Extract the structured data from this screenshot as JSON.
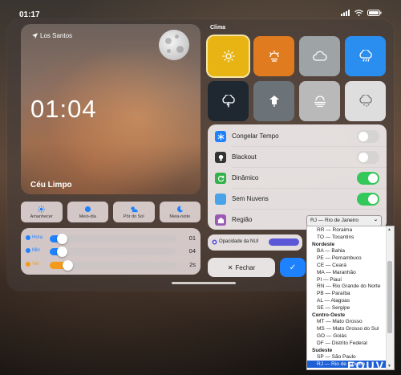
{
  "statusbar": {
    "time": "01:17"
  },
  "weather": {
    "location": "Los Santos",
    "clock": "01:04",
    "condition": "Céu Limpo"
  },
  "time_of_day": [
    {
      "label": "Amanhecer",
      "icon": "sun-icon"
    },
    {
      "label": "Meio-dia",
      "icon": "sun-full-icon"
    },
    {
      "label": "Pôr do Sol",
      "icon": "sunset-icon"
    },
    {
      "label": "Meia-noite",
      "icon": "moon-icon"
    }
  ],
  "sliders": [
    {
      "label": "Hora",
      "value": "01",
      "color": "#1e82ff",
      "fraction": 0.06
    },
    {
      "label": "Min",
      "value": "04",
      "color": "#1e82ff",
      "fraction": 0.06
    },
    {
      "label": "Vel",
      "value": "2s",
      "color": "#f39a1a",
      "fraction": 0.1
    }
  ],
  "clima": {
    "title": "Clima",
    "types": [
      {
        "name": "clear-sun-icon",
        "color": "#e8b414",
        "selected": true
      },
      {
        "name": "haze-sun-icon",
        "color": "#e07b1f",
        "selected": false
      },
      {
        "name": "cloud-icon",
        "color": "#9ea3a6",
        "selected": false
      },
      {
        "name": "rain-cloud-icon",
        "color": "#2a8df0",
        "selected": false
      },
      {
        "name": "thunder-cloud-icon",
        "color": "#1f2830",
        "selected": false
      },
      {
        "name": "overcast-icon",
        "color": "#6c7378",
        "selected": false
      },
      {
        "name": "fog-icon",
        "color": "#b9b9b9",
        "selected": false
      },
      {
        "name": "snow-cloud-icon",
        "color": "#dedede",
        "selected": false
      }
    ]
  },
  "options": [
    {
      "label": "Congelar Tempo",
      "icon": "snowflake-icon",
      "icon_color": "#1e82ff",
      "on": false
    },
    {
      "label": "Blackout",
      "icon": "bulb-icon",
      "icon_color": "#333333",
      "on": false
    },
    {
      "label": "Dinâmico",
      "icon": "refresh-icon",
      "icon_color": "#32b24a",
      "on": true
    },
    {
      "label": "Sem Nuvens",
      "icon": "sky-icon",
      "icon_color": "#4aa3e8",
      "on": true
    },
    {
      "label": "Região",
      "icon": "region-icon",
      "icon_color": "#9b59b6"
    }
  ],
  "region": {
    "selected": "RJ — Rio de Janeiro"
  },
  "opacity": {
    "label": "Opacidade da NUI"
  },
  "buttons": {
    "close": "Fechar"
  },
  "dropdown": [
    {
      "type": "item",
      "text": "RR — Roraima"
    },
    {
      "type": "item",
      "text": "TO — Tocantins"
    },
    {
      "type": "group",
      "text": "Nordeste"
    },
    {
      "type": "item",
      "text": "BA — Bahia"
    },
    {
      "type": "item",
      "text": "PE — Pernambuco"
    },
    {
      "type": "item",
      "text": "CE — Ceará"
    },
    {
      "type": "item",
      "text": "MA — Maranhão"
    },
    {
      "type": "item",
      "text": "PI — Piauí"
    },
    {
      "type": "item",
      "text": "RN — Rio Grande do Norte"
    },
    {
      "type": "item",
      "text": "PB — Paraíba"
    },
    {
      "type": "item",
      "text": "AL — Alagoas"
    },
    {
      "type": "item",
      "text": "SE — Sergipe"
    },
    {
      "type": "group",
      "text": "Centro-Oeste"
    },
    {
      "type": "item",
      "text": "MT — Mato Grosso"
    },
    {
      "type": "item",
      "text": "MS — Mato Grosso do Sul"
    },
    {
      "type": "item",
      "text": "GO — Goiás"
    },
    {
      "type": "item",
      "text": "DF — Distrito Federal"
    },
    {
      "type": "group",
      "text": "Sudeste"
    },
    {
      "type": "item",
      "text": "SP — São Paulo"
    },
    {
      "type": "item",
      "text": "RJ — Rio de Janeiro",
      "selected": true
    }
  ],
  "watermark": "FOUV"
}
